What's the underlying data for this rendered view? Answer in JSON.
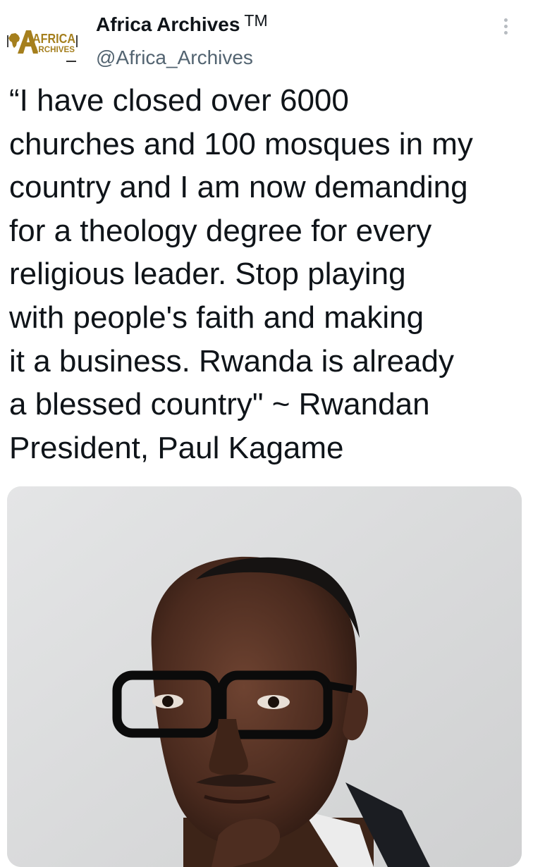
{
  "account": {
    "display_name": "Africa Archives",
    "trademark": "TM",
    "handle": "@Africa_Archives",
    "avatar": {
      "icon": "africa-archives-logo-icon",
      "logo_line1": "AFRICA",
      "logo_line2": "ARCHIVES",
      "brand_color": "#a57f1d"
    }
  },
  "menu": {
    "icon": "more-vertical-icon"
  },
  "tweet": {
    "text_lines": [
      "“I have closed over 6000",
      "churches and 100 mosques in my",
      "country and I am now demanding",
      "for a theology degree for every",
      "religious leader. Stop playing",
      "with people's faith and making",
      "it a business. Rwanda is already",
      "a blessed country\" ~ Rwandan",
      "President, Paul Kagame"
    ]
  },
  "media": {
    "type": "photo",
    "background_color": "#d9dadb"
  },
  "colors": {
    "text_primary": "#0f1419",
    "text_secondary": "#536471",
    "menu_dots": "#b7bcc1"
  }
}
